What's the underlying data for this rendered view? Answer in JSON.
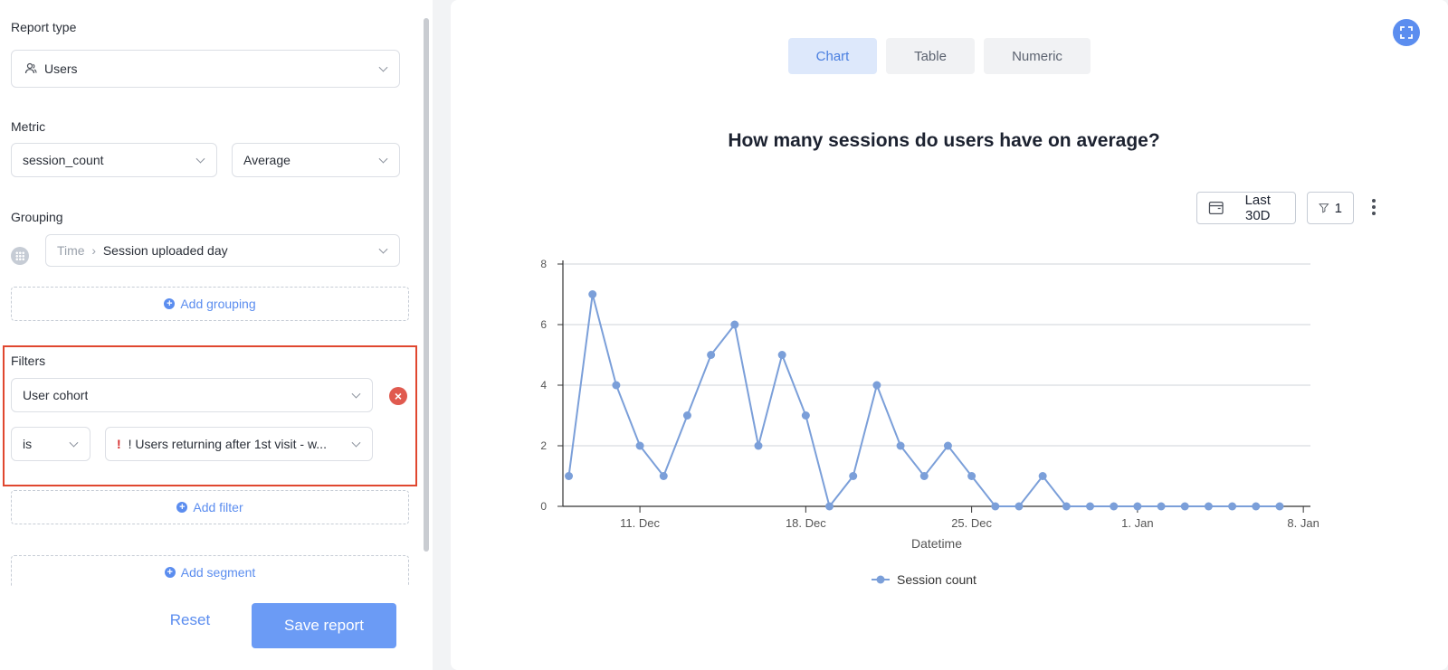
{
  "sidebar": {
    "report_type": {
      "label": "Report type",
      "value": "Users",
      "icon": "users-icon"
    },
    "metric": {
      "label": "Metric",
      "field": "session_count",
      "aggregation": "Average"
    },
    "grouping": {
      "label": "Grouping",
      "prefix": "Time",
      "value": "Session uploaded day",
      "add_label": "Add grouping"
    },
    "filters": {
      "label": "Filters",
      "field": "User cohort",
      "operator": "is",
      "value": "! Users returning after 1st visit - w...",
      "add_label": "Add filter"
    },
    "segment": {
      "add_label": "Add segment"
    },
    "reset_label": "Reset",
    "save_label": "Save report"
  },
  "view_tabs": [
    {
      "label": "Chart",
      "active": true
    },
    {
      "label": "Table",
      "active": false
    },
    {
      "label": "Numeric",
      "active": false
    }
  ],
  "controls": {
    "date_range": "Last 30D",
    "filter_count": "1"
  },
  "colors": {
    "accent": "#5b8def",
    "series": "#7b9fd9",
    "highlight_border": "#e0472f"
  },
  "chart_data": {
    "type": "line",
    "title": "How many sessions do users have on average?",
    "xlabel": "Datetime",
    "ylabel": "",
    "x_start": "2023-12-08",
    "x_ticks": [
      "11. Dec",
      "18. Dec",
      "25. Dec",
      "1. Jan",
      "8. Jan"
    ],
    "x_tick_dates": [
      "2023-12-11",
      "2023-12-18",
      "2023-12-25",
      "2024-01-01",
      "2024-01-08"
    ],
    "ylim": [
      0,
      8
    ],
    "y_ticks": [
      0,
      2,
      4,
      6,
      8
    ],
    "grid": true,
    "legend": "bottom",
    "series": [
      {
        "name": "Session count",
        "x": [
          "2023-12-08",
          "2023-12-09",
          "2023-12-10",
          "2023-12-11",
          "2023-12-12",
          "2023-12-13",
          "2023-12-14",
          "2023-12-15",
          "2023-12-16",
          "2023-12-17",
          "2023-12-18",
          "2023-12-19",
          "2023-12-20",
          "2023-12-21",
          "2023-12-22",
          "2023-12-23",
          "2023-12-24",
          "2023-12-25",
          "2023-12-26",
          "2023-12-27",
          "2023-12-28",
          "2023-12-29",
          "2023-12-30",
          "2023-12-31",
          "2024-01-01",
          "2024-01-02",
          "2024-01-03",
          "2024-01-04",
          "2024-01-05",
          "2024-01-06",
          "2024-01-07"
        ],
        "values": [
          1,
          7,
          4,
          2,
          1,
          3,
          5,
          6,
          2,
          5,
          3,
          0,
          1,
          4,
          2,
          1,
          2,
          1,
          0,
          0,
          1,
          0,
          0,
          0,
          0,
          0,
          0,
          0,
          0,
          0,
          0
        ]
      }
    ]
  }
}
